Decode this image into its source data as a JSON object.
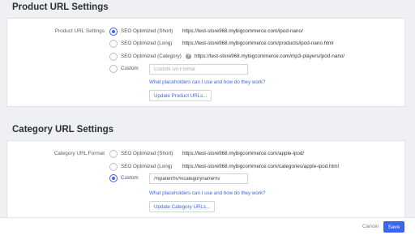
{
  "product": {
    "title": "Product URL Settings",
    "field_label": "Product URL Settings",
    "options": [
      {
        "label": "SEO Optimized (Short)",
        "url": "https://test-store968.mybigcommerce.com/ipod-nano/",
        "checked": true
      },
      {
        "label": "SEO Optimized (Long)",
        "url": "https://test-store968.mybigcommerce.com/products/ipod-nano.html",
        "checked": false
      },
      {
        "label": "SEO Optimized (Category)",
        "url": "https://test-store968.mybigcommerce.com/mp3-players/ipod-nano/",
        "checked": false,
        "help_icon": "?"
      },
      {
        "label": "Custom",
        "checked": false
      }
    ],
    "custom_placeholder": "Custom Url Format",
    "custom_value": "",
    "help_link": "What placeholders can I use and how do they work?",
    "update_button": "Update Product URLs..."
  },
  "category": {
    "title": "Category URL Settings",
    "field_label": "Category URL Format",
    "options": [
      {
        "label": "SEO Optimized (Short)",
        "url": "https://test-store968.mybigcommerce.com/apple-ipod/",
        "checked": false
      },
      {
        "label": "SEO Optimized (Long)",
        "url": "https://test-store968.mybigcommerce.com/categories/apple-ipod.html",
        "checked": false
      },
      {
        "label": "Custom",
        "checked": true
      }
    ],
    "custom_placeholder": "",
    "custom_value": "/%parent%/%categoryname%/",
    "help_link": "What placeholders can I use and how do they work?",
    "update_button": "Update Category URLs..."
  },
  "footer": {
    "cancel_label": "Cancel",
    "save_label": "Save"
  },
  "colors": {
    "accent": "#3c64f4",
    "background": "#eef0f4",
    "panel": "#ffffff"
  }
}
